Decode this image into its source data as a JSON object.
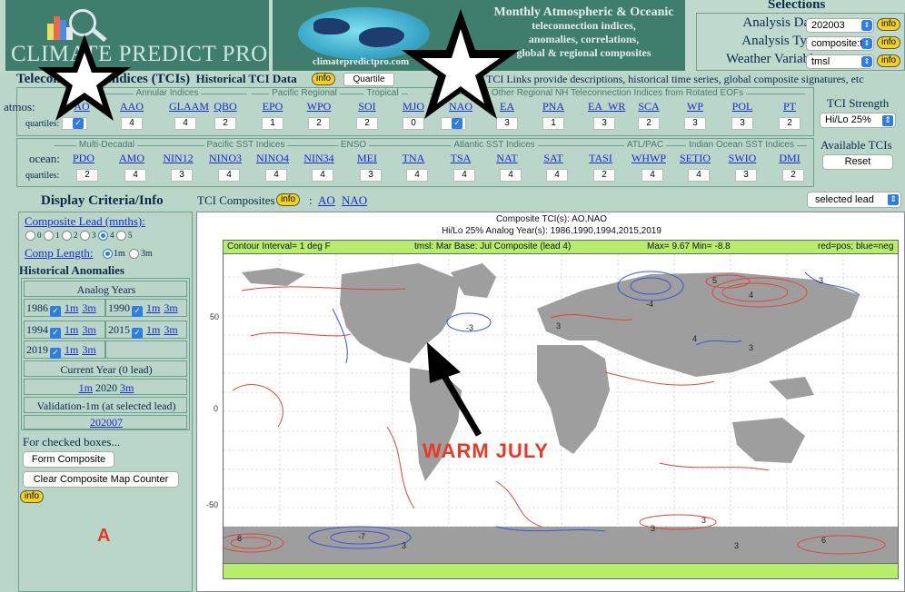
{
  "app": {
    "brand": "CLIMATE PREDICT PRO",
    "url": "climatepredictpro.com",
    "description": [
      "Monthly Atmospheric & Oceanic",
      "teleconnection indices,",
      "anomalies, correlations,",
      "global & regional composites"
    ]
  },
  "selections": {
    "title": "Selections",
    "rows": [
      {
        "label": "Analysis Date",
        "value": "202003",
        "info": "info"
      },
      {
        "label": "Analysis Type",
        "value": "composite:t",
        "info": "info"
      },
      {
        "label": "Weather Variable",
        "value": "tmsl",
        "info": "info"
      }
    ]
  },
  "tci": {
    "heading_a": "Teleconnection Indices (TCIs)",
    "heading_b": "Historical TCI Data",
    "info": "info",
    "quartile_button": "Quartile",
    "note": "TCI Links provide descriptions, historical time series, global composite signatures, etc",
    "atmos_label": "atmos:",
    "ocean_label": "ocean:",
    "quartiles_label": "quartiles:",
    "atmos_groups": [
      "Annular Indices",
      "Pacific Regional",
      "Tropical",
      "Other Regional NH Teleconnection Indices from Rotated EOFs"
    ],
    "ocean_groups": [
      "Multi-Decadal",
      "Pacific SST Indices",
      "ENSO",
      "Atlantic SST Indices",
      "ATL/PAC",
      "Indian Ocean SST Indices"
    ],
    "atmos": [
      {
        "name": "AO",
        "q": "4",
        "checked": true
      },
      {
        "name": "AAO",
        "q": "4",
        "checked": false
      },
      {
        "name": "GLAAM",
        "q": "4",
        "checked": false
      },
      {
        "name": "QBO",
        "q": "2",
        "checked": false
      },
      {
        "name": "EPO",
        "q": "1",
        "checked": false
      },
      {
        "name": "WPO",
        "q": "2",
        "checked": false
      },
      {
        "name": "SOI",
        "q": "2",
        "checked": false
      },
      {
        "name": "MJO",
        "q": "0",
        "checked": false
      },
      {
        "name": "NAO",
        "q": "4",
        "checked": true
      },
      {
        "name": "EA",
        "q": "3",
        "checked": false
      },
      {
        "name": "PNA",
        "q": "1",
        "checked": false
      },
      {
        "name": "EA_WR",
        "q": "3",
        "checked": false
      },
      {
        "name": "SCA",
        "q": "2",
        "checked": false
      },
      {
        "name": "WP",
        "q": "3",
        "checked": false
      },
      {
        "name": "POL",
        "q": "3",
        "checked": false
      },
      {
        "name": "PT",
        "q": "2",
        "checked": false
      }
    ],
    "ocean": [
      {
        "name": "PDO",
        "q": "2"
      },
      {
        "name": "AMO",
        "q": "4"
      },
      {
        "name": "NIN12",
        "q": "3"
      },
      {
        "name": "NINO3",
        "q": "4"
      },
      {
        "name": "NINO4",
        "q": "4"
      },
      {
        "name": "NIN34",
        "q": "4"
      },
      {
        "name": "MEI",
        "q": "3"
      },
      {
        "name": "TNA",
        "q": "4"
      },
      {
        "name": "TSA",
        "q": "4"
      },
      {
        "name": "NAT",
        "q": "4"
      },
      {
        "name": "SAT",
        "q": "4"
      },
      {
        "name": "TASI",
        "q": "2"
      },
      {
        "name": "WHWP",
        "q": "4"
      },
      {
        "name": "SETIO",
        "q": "4"
      },
      {
        "name": "SWIO",
        "q": "3"
      },
      {
        "name": "DMI",
        "q": "2"
      }
    ],
    "strength_label": "TCI Strength",
    "strength_value": "Hi/Lo 25%",
    "available_label": "Available TCIs",
    "reset": "Reset"
  },
  "display": {
    "title": "Display Criteria/Info",
    "composites_label": "TCI Composites",
    "composites_info": "info",
    "composites": [
      "AO",
      "NAO"
    ],
    "lead_select": "selected lead",
    "composite_lead_label": "Composite Lead (mnths):",
    "leads": [
      "0",
      "1",
      "2",
      "3",
      "4",
      "5"
    ],
    "selected_lead": "4",
    "comp_length_label": "Comp Length:",
    "comp_lengths": [
      "1m",
      "3m"
    ],
    "historical_label": "Historical Anomalies",
    "analog_years_label": "Analog Years",
    "years": [
      {
        "year": "1986",
        "m1": "1m",
        "m3": "3m"
      },
      {
        "year": "1990",
        "m1": "1m",
        "m3": "3m"
      },
      {
        "year": "1994",
        "m1": "1m",
        "m3": "3m"
      },
      {
        "year": "2015",
        "m1": "1m",
        "m3": "3m"
      },
      {
        "year": "2019",
        "m1": "1m",
        "m3": "3m"
      }
    ],
    "current_year_label": "Current Year (0 lead)",
    "current_year": {
      "m1": "1m",
      "year": "2020",
      "m3": "3m"
    },
    "validation_label": "Validation-1m (at selected lead)",
    "validation_link": "202007",
    "for_checked": "For checked boxes...",
    "form_composite": "Form Composite",
    "clear_counter": "Clear Composite Map Counter",
    "info": "info",
    "marker": "A"
  },
  "map": {
    "title1": "Composite TCI(s): AO,NAO",
    "title2": "Hi/Lo 25% Analog Year(s): 1986,1990,1994,2015,2019",
    "bar_left": "Contour Interval= 1 deg F",
    "bar_mid": "tmsl:  Mar Base:  Jul Composite (lead 4)",
    "bar_maxmin": "Max= 9.67  Min= -8.8",
    "bar_right": "red=pos; blue=neg",
    "yticks": [
      "50",
      "0",
      "-50"
    ],
    "overlay_text": "WARM JULY",
    "contour_labels": [
      "5",
      "4",
      "-3",
      "-4",
      "-3",
      "3",
      "4",
      "3",
      "8",
      "-7",
      "3",
      "3",
      "3",
      "3",
      "6"
    ]
  },
  "colors": {
    "bg": "#b9d6c9",
    "brand": "#3f7d6d",
    "link": "#1a2bd0",
    "info": "#f3d218",
    "warm": "#e63a26",
    "bar": "#b6ee6c"
  }
}
